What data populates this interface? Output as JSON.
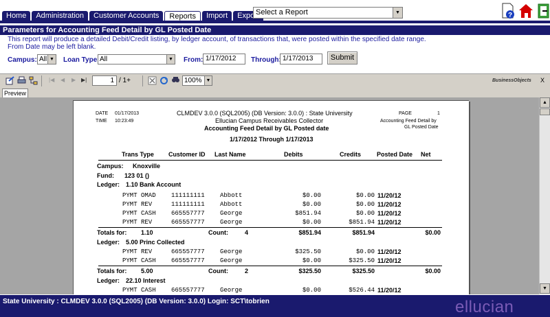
{
  "tabs": [
    {
      "label": "Home",
      "active": false
    },
    {
      "label": "Administration",
      "active": false
    },
    {
      "label": "Customer Accounts",
      "active": false
    },
    {
      "label": "Reports",
      "active": true
    },
    {
      "label": "Import",
      "active": false
    },
    {
      "label": "Export",
      "active": false
    }
  ],
  "report_select": {
    "value": "Select a Report"
  },
  "params": {
    "header": "Parameters for Accounting Feed Detail by GL Posted Date",
    "desc_line1": "This report will produce a detailed Debit/Credit listing, by ledger account, of transactions that, were posted within the specified date range.",
    "desc_line2": "From Date may be left blank.",
    "campus_label": "Campus:",
    "campus_value": "All",
    "loantype_label": "Loan Type:",
    "loantype_value": "All",
    "from_label": "From:",
    "from_value": "1/17/2012",
    "through_label": "Through:",
    "through_value": "1/17/2013",
    "submit_label": "Submit"
  },
  "viewer": {
    "page_value": "1",
    "page_total": "/ 1+",
    "zoom": "100%",
    "brand": "BusinessObjects",
    "close": "X",
    "preview_tab": "Preview"
  },
  "report": {
    "date_label": "DATE",
    "date_value": "01/17/2013",
    "time_label": "TIME",
    "time_value": "10:23:49",
    "server_line": "CLMDEV 3.0.0 (SQL2005) (DB Version: 3.0.0) : State University",
    "company_line": "Ellucian Campus Receivables Collector",
    "title": "Accounting Feed Detail by GL Posted date",
    "date_range": "1/17/2012 Through 1/17/2013",
    "page_label": "PAGE",
    "page_num": "1",
    "page_sub1": "Accounting Feed Detail by",
    "page_sub2": "GL Posted Date",
    "columns": [
      "Trans Type",
      "Customer ID",
      "Last Name",
      "Debits",
      "Credits",
      "Posted Date",
      "Net"
    ],
    "campus_label": "Campus:",
    "campus_value": "Knoxville",
    "fund_label": "Fund:",
    "fund_value": "123 01 ()",
    "ledger_label": "Ledger:",
    "ledger1": "1.10 Bank Account",
    "ledger1_rows": [
      {
        "type": "PYMT  OMAD",
        "cid": "111111111",
        "name": "Abbott",
        "debit": "$0.00",
        "credit": "$0.00",
        "posted": "11/20/12"
      },
      {
        "type": "PYMT  REV",
        "cid": "111111111",
        "name": "Abbott",
        "debit": "$0.00",
        "credit": "$0.00",
        "posted": "11/20/12"
      },
      {
        "type": "PYMT  CASH",
        "cid": "665557777",
        "name": "George",
        "debit": "$851.94",
        "credit": "$0.00",
        "posted": "11/20/12"
      },
      {
        "type": "PYMT  REV",
        "cid": "665557777",
        "name": "George",
        "debit": "$0.00",
        "credit": "$851.94",
        "posted": "11/20/12"
      }
    ],
    "totals_label": "Totals for:",
    "count_label": "Count:",
    "ledger1_totals": {
      "acct": "1.10",
      "count": "4",
      "debit": "$851.94",
      "credit": "$851.94",
      "net": "$0.00"
    },
    "ledger2": "5.00 Princ Collected",
    "ledger2_rows": [
      {
        "type": "PYMT  REV",
        "cid": "665557777",
        "name": "George",
        "debit": "$325.50",
        "credit": "$0.00",
        "posted": "11/20/12"
      },
      {
        "type": "PYMT  CASH",
        "cid": "665557777",
        "name": "George",
        "debit": "$0.00",
        "credit": "$325.50",
        "posted": "11/20/12"
      }
    ],
    "ledger2_totals": {
      "acct": "5.00",
      "count": "2",
      "debit": "$325.50",
      "credit": "$325.50",
      "net": "$0.00"
    },
    "ledger3": "22.10 Interest",
    "ledger3_rows": [
      {
        "type": "PYMT  CASH",
        "cid": "665557777",
        "name": "George",
        "debit": "$0.00",
        "credit": "$526.44",
        "posted": "11/20/12"
      }
    ]
  },
  "footer": {
    "status": "State University : CLMDEV 3.0.0 (SQL2005) (DB Version: 3.0.0) Login: SCT\\tobrien",
    "brand": "ellucian"
  }
}
